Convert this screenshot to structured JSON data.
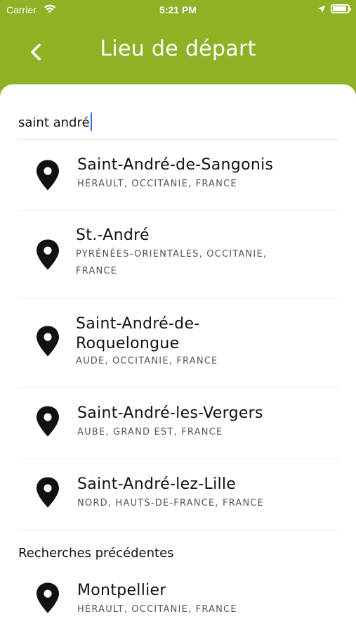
{
  "status_bar": {
    "carrier": "Carrier",
    "time": "5:21 PM",
    "battery_level": 0.9
  },
  "header": {
    "title": "Lieu de départ"
  },
  "search": {
    "value": "saint andré"
  },
  "results": [
    {
      "name": "Saint-André-de-Sangonis",
      "region": "HÉRAULT, OCCITANIE, FRANCE"
    },
    {
      "name": "St.-André",
      "region_line1": "PYRÉNÉES-ORIENTALES, OCCITANIE,",
      "region_line2": "FRANCE"
    },
    {
      "name_line1": "Saint-André-de-",
      "name_line2": "Roquelongue",
      "region": "AUDE, OCCITANIE, FRANCE"
    },
    {
      "name": "Saint-André-les-Vergers",
      "region": "AUBE, GRAND EST, FRANCE"
    },
    {
      "name": "Saint-André-lez-Lille",
      "region": "NORD, HAUTS-DE-FRANCE, FRANCE"
    }
  ],
  "recent": {
    "heading": "Recherches précédentes",
    "items": [
      {
        "name": "Montpellier",
        "region": "HÉRAULT, OCCITANIE, FRANCE"
      }
    ]
  },
  "colors": {
    "brand": "#8fb125",
    "caret": "#2f6ee8",
    "divider": "#e9ecd2"
  },
  "icons": {
    "back": "chevron-left-icon",
    "pin": "map-pin-icon"
  }
}
